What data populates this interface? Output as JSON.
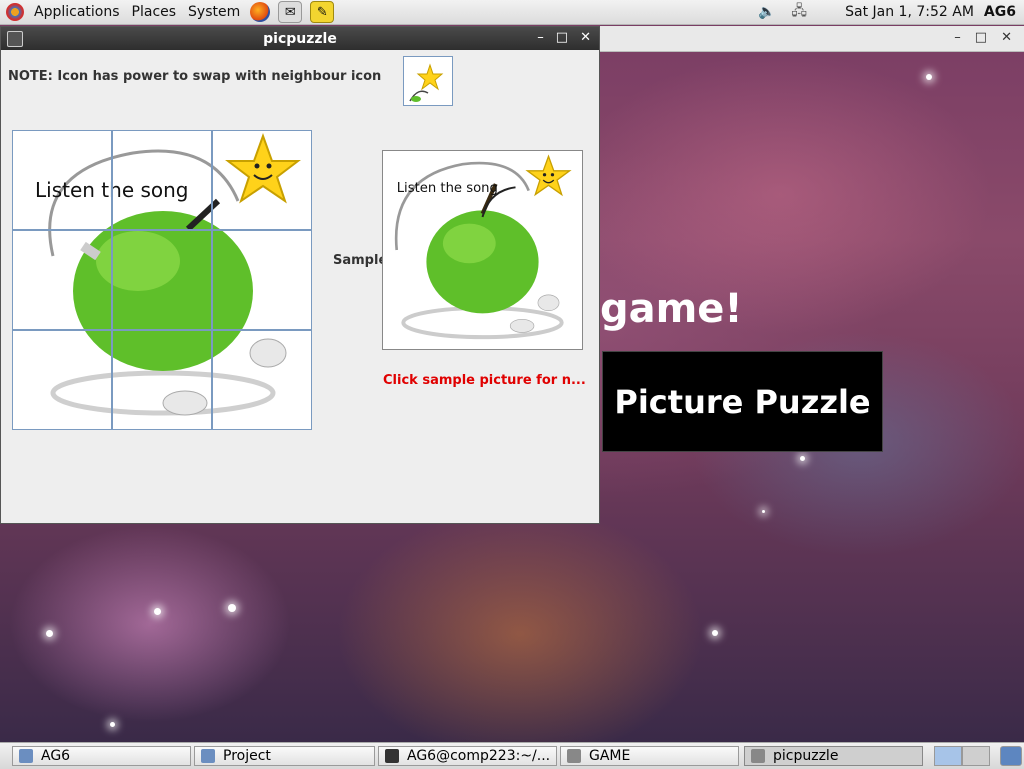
{
  "top_panel": {
    "menus": [
      "Applications",
      "Places",
      "System"
    ],
    "clock": "Sat Jan  1,  7:52 AM",
    "user": "AG6"
  },
  "background": {
    "game_text": "game!",
    "picture_puzzle": "Picture Puzzle"
  },
  "window": {
    "title": "picpuzzle",
    "note": "NOTE: Icon has power to swap with neighbour icon",
    "sample_label": "Sample",
    "click_note": "Click sample picture for n...",
    "tile_caption": "Listen the song",
    "sample_caption": "Listen the song"
  },
  "taskbar": {
    "items": [
      {
        "label": "AG6",
        "icon": "folder-home-icon"
      },
      {
        "label": "Project",
        "icon": "folder-icon"
      },
      {
        "label": "AG6@comp223:~/...",
        "icon": "terminal-icon"
      },
      {
        "label": "GAME",
        "icon": "java-app-icon"
      },
      {
        "label": "picpuzzle",
        "icon": "java-app-icon"
      }
    ]
  },
  "colors": {
    "note_red": "#e00000",
    "apple_green": "#5fbf2a",
    "star_yellow": "#ffd21a"
  }
}
